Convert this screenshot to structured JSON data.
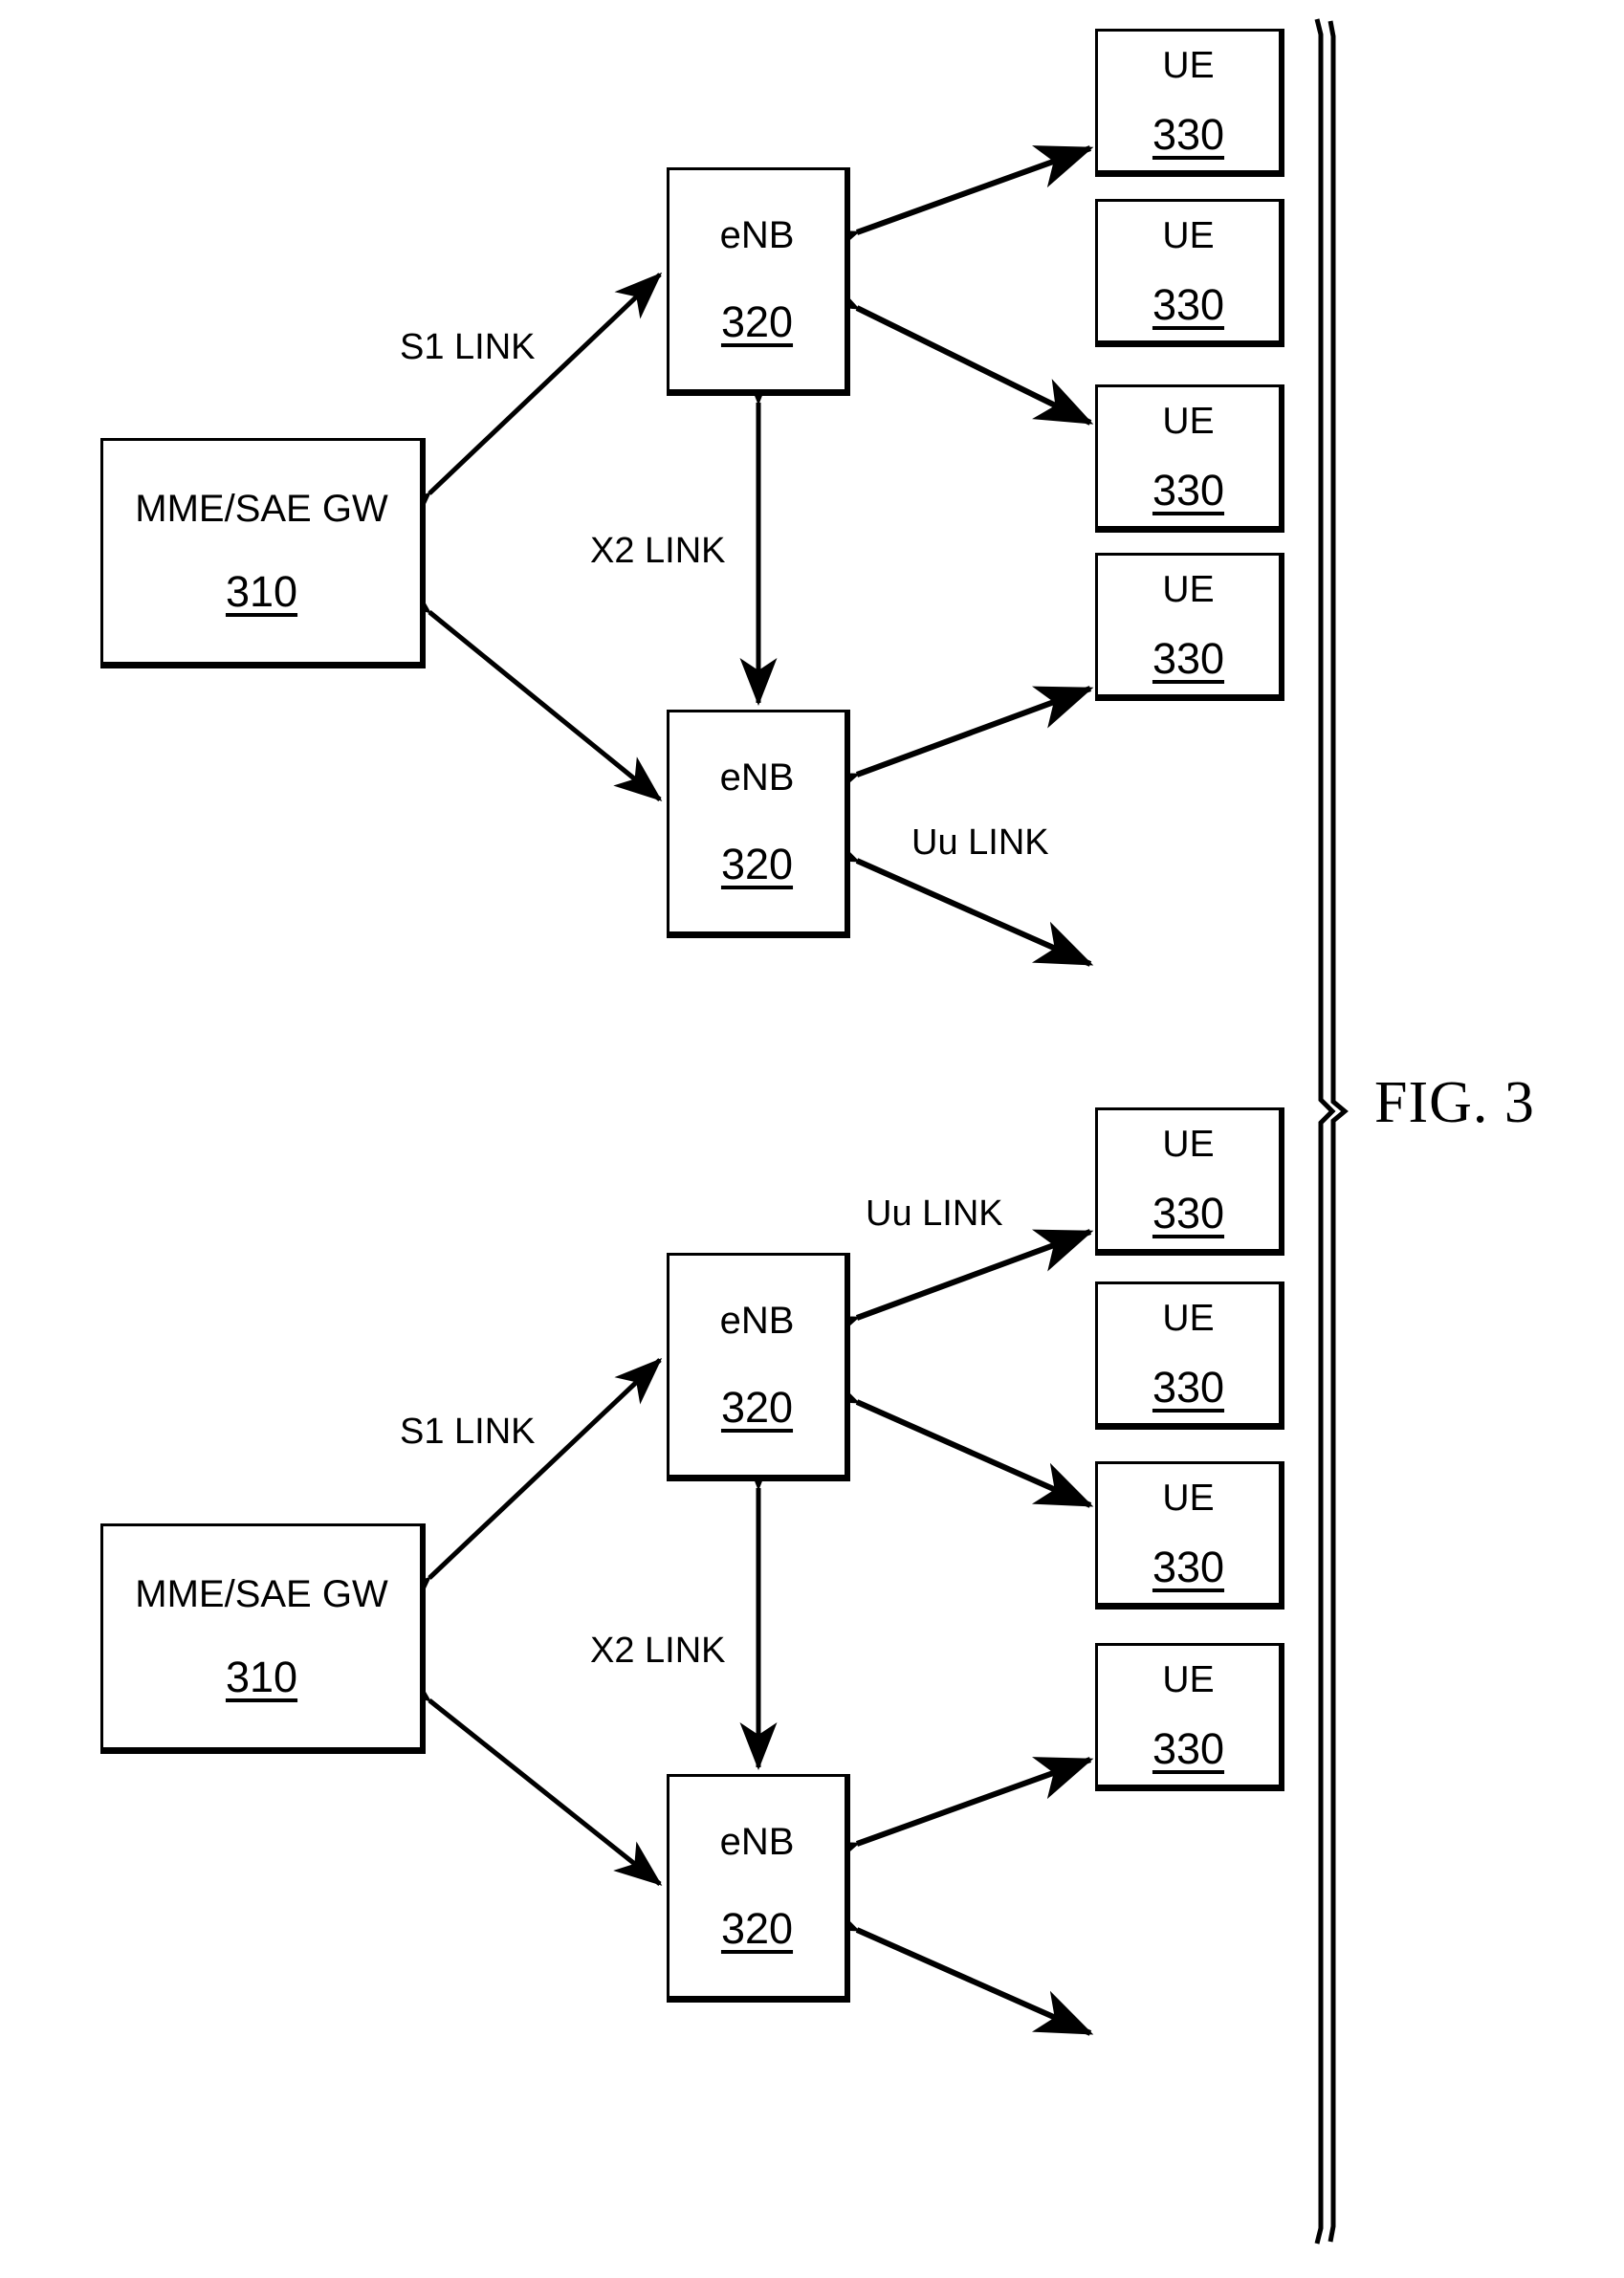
{
  "figure": {
    "caption": "FIG. 3",
    "bracket_icon": "right-brace-bracket"
  },
  "groups": [
    {
      "id": "upper-network",
      "core": {
        "title": "MME/SAE GW",
        "ref": "310"
      },
      "base_stations": [
        {
          "title": "eNB",
          "ref": "320"
        },
        {
          "title": "eNB",
          "ref": "320"
        }
      ],
      "terminals": [
        {
          "title": "UE",
          "ref": "330"
        },
        {
          "title": "UE",
          "ref": "330"
        },
        {
          "title": "UE",
          "ref": "330"
        },
        {
          "title": "UE",
          "ref": "330"
        }
      ],
      "links": [
        {
          "label": "S1 LINK"
        },
        {
          "label": "X2 LINK"
        },
        {
          "label": "Uu LINK"
        }
      ]
    },
    {
      "id": "lower-network",
      "core": {
        "title": "MME/SAE GW",
        "ref": "310"
      },
      "base_stations": [
        {
          "title": "eNB",
          "ref": "320"
        },
        {
          "title": "eNB",
          "ref": "320"
        }
      ],
      "terminals": [
        {
          "title": "UE",
          "ref": "330"
        },
        {
          "title": "UE",
          "ref": "330"
        },
        {
          "title": "UE",
          "ref": "330"
        },
        {
          "title": "UE",
          "ref": "330"
        }
      ],
      "links": [
        {
          "label": "S1 LINK"
        },
        {
          "label": "X2 LINK"
        },
        {
          "label": "Uu LINK"
        }
      ]
    }
  ]
}
